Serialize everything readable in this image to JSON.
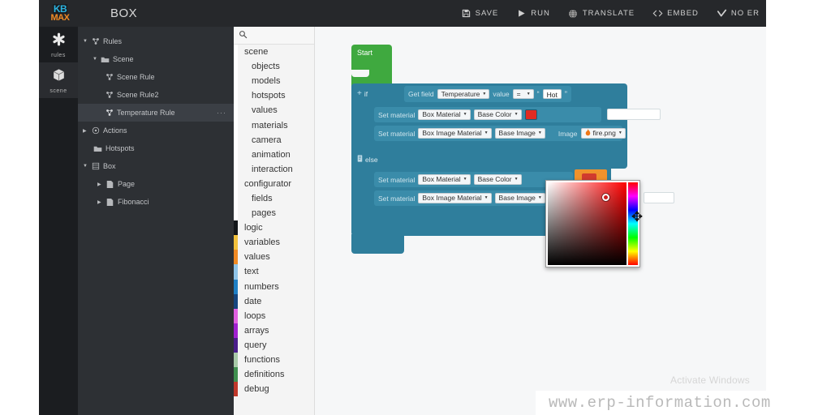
{
  "header": {
    "logo_top": "KB",
    "logo_bottom": "MAX",
    "title": "BOX",
    "toolbar": [
      {
        "label": "SAVE",
        "icon": "save-icon"
      },
      {
        "label": "RUN",
        "icon": "play-icon"
      },
      {
        "label": "TRANSLATE",
        "icon": "globe-icon"
      },
      {
        "label": "EMBED",
        "icon": "code-brackets-icon"
      },
      {
        "label": "NO ER",
        "icon": "check-icon"
      }
    ]
  },
  "rail": {
    "items": [
      {
        "label": "rules",
        "icon": "gear-asterisk-icon",
        "active": false
      },
      {
        "label": "scene",
        "icon": "cube-icon",
        "active": true
      }
    ]
  },
  "tree": {
    "nodes": [
      {
        "label": "Rules",
        "icon": "rules-icon",
        "caret": "▼",
        "indent": 0,
        "selected": false,
        "menu": ""
      },
      {
        "label": "Scene",
        "icon": "folder-icon",
        "caret": "▼",
        "indent": 1,
        "selected": false,
        "menu": ""
      },
      {
        "label": "Scene Rule",
        "icon": "rule-icon",
        "caret": "",
        "indent": 2,
        "selected": false,
        "menu": ""
      },
      {
        "label": "Scene Rule2",
        "icon": "rule-icon",
        "caret": "",
        "indent": 2,
        "selected": false,
        "menu": ""
      },
      {
        "label": "Temperature Rule",
        "icon": "rule-icon",
        "caret": "",
        "indent": 2,
        "selected": true,
        "menu": "···"
      },
      {
        "label": "Actions",
        "icon": "actions-icon",
        "caret": "▶",
        "indent": 0,
        "selected": false,
        "menu": ""
      },
      {
        "label": "Hotspots",
        "icon": "folder-icon",
        "caret": "",
        "indent": 1,
        "selected": false,
        "menu": ""
      },
      {
        "label": "Box",
        "icon": "grid-icon",
        "caret": "▼",
        "indent": 0,
        "selected": false,
        "menu": ""
      },
      {
        "label": "Page",
        "icon": "page-icon",
        "caret": "▶",
        "indent": 1,
        "selected": false,
        "menu": ""
      },
      {
        "label": "Fibonacci",
        "icon": "page-icon",
        "caret": "▶",
        "indent": 1,
        "selected": false,
        "menu": ""
      }
    ]
  },
  "toolbox": {
    "search_icon": "search-icon",
    "categories": [
      {
        "label": "scene",
        "sub": false,
        "color": "#ffffff"
      },
      {
        "label": "objects",
        "sub": true,
        "color": "#ffffff"
      },
      {
        "label": "models",
        "sub": true,
        "color": "#ffffff"
      },
      {
        "label": "hotspots",
        "sub": true,
        "color": "#ffffff"
      },
      {
        "label": "values",
        "sub": true,
        "color": "#ffffff"
      },
      {
        "label": "materials",
        "sub": true,
        "color": "#ffffff"
      },
      {
        "label": "camera",
        "sub": true,
        "color": "#ffffff"
      },
      {
        "label": "animation",
        "sub": true,
        "color": "#ffffff"
      },
      {
        "label": "interaction",
        "sub": true,
        "color": "#ffffff"
      },
      {
        "label": "configurator",
        "sub": false,
        "color": "#ffffff"
      },
      {
        "label": "fields",
        "sub": true,
        "color": "#ffffff"
      },
      {
        "label": "pages",
        "sub": true,
        "color": "#ffffff"
      },
      {
        "label": "logic",
        "sub": false,
        "color": "#12161a"
      },
      {
        "label": "variables",
        "sub": false,
        "color": "#f2c13c"
      },
      {
        "label": "values",
        "sub": false,
        "color": "#f08a24"
      },
      {
        "label": "text",
        "sub": false,
        "color": "#8fc4e8"
      },
      {
        "label": "numbers",
        "sub": false,
        "color": "#1f7fc4"
      },
      {
        "label": "date",
        "sub": false,
        "color": "#15457e"
      },
      {
        "label": "loops",
        "sub": false,
        "color": "#e060e0"
      },
      {
        "label": "arrays",
        "sub": false,
        "color": "#a020d0"
      },
      {
        "label": "query",
        "sub": false,
        "color": "#4a1d8a"
      },
      {
        "label": "functions",
        "sub": false,
        "color": "#a8c9a8"
      },
      {
        "label": "definitions",
        "sub": false,
        "color": "#3f8f4f"
      },
      {
        "label": "debug",
        "sub": false,
        "color": "#c0392b"
      }
    ]
  },
  "workspace": {
    "start_block": {
      "label": "Start",
      "color": "#3fa93f"
    },
    "if_block": {
      "label": "if",
      "plus": "+",
      "condition": {
        "get_field_label": "Get field",
        "field": "Temperature",
        "value_label": "value",
        "operator": "=",
        "quote_open": "“",
        "quote_close": "”",
        "compare_value": "Hot"
      },
      "statements": [
        {
          "label": "Set material",
          "material": "Box Material",
          "property": "Base Color",
          "swatch_color": "#e02b22",
          "kind": "color"
        },
        {
          "label": "Set material",
          "material": "Box Image Material",
          "property": "Base Image",
          "image_label": "Image",
          "image_icon": "fire-icon",
          "image_value": "fire.png",
          "kind": "image"
        }
      ]
    },
    "else_block": {
      "label": "else",
      "icon": "note-icon",
      "statements": [
        {
          "label": "Set material",
          "material": "Box Material",
          "property": "Base Color",
          "swatch_color": "#d13b2e",
          "kind": "color"
        },
        {
          "label": "Set material",
          "material": "Box Image Material",
          "property": "Base Image",
          "kind": "image"
        }
      ]
    },
    "color_picker": {
      "name": "color-picker-popup",
      "hue_color": "#ff0000",
      "selected_color": "#cc1f1f",
      "cursor": "move-cursor"
    }
  },
  "watermarks": {
    "activate": "Activate Windows",
    "site": "www.erp-information.com"
  }
}
